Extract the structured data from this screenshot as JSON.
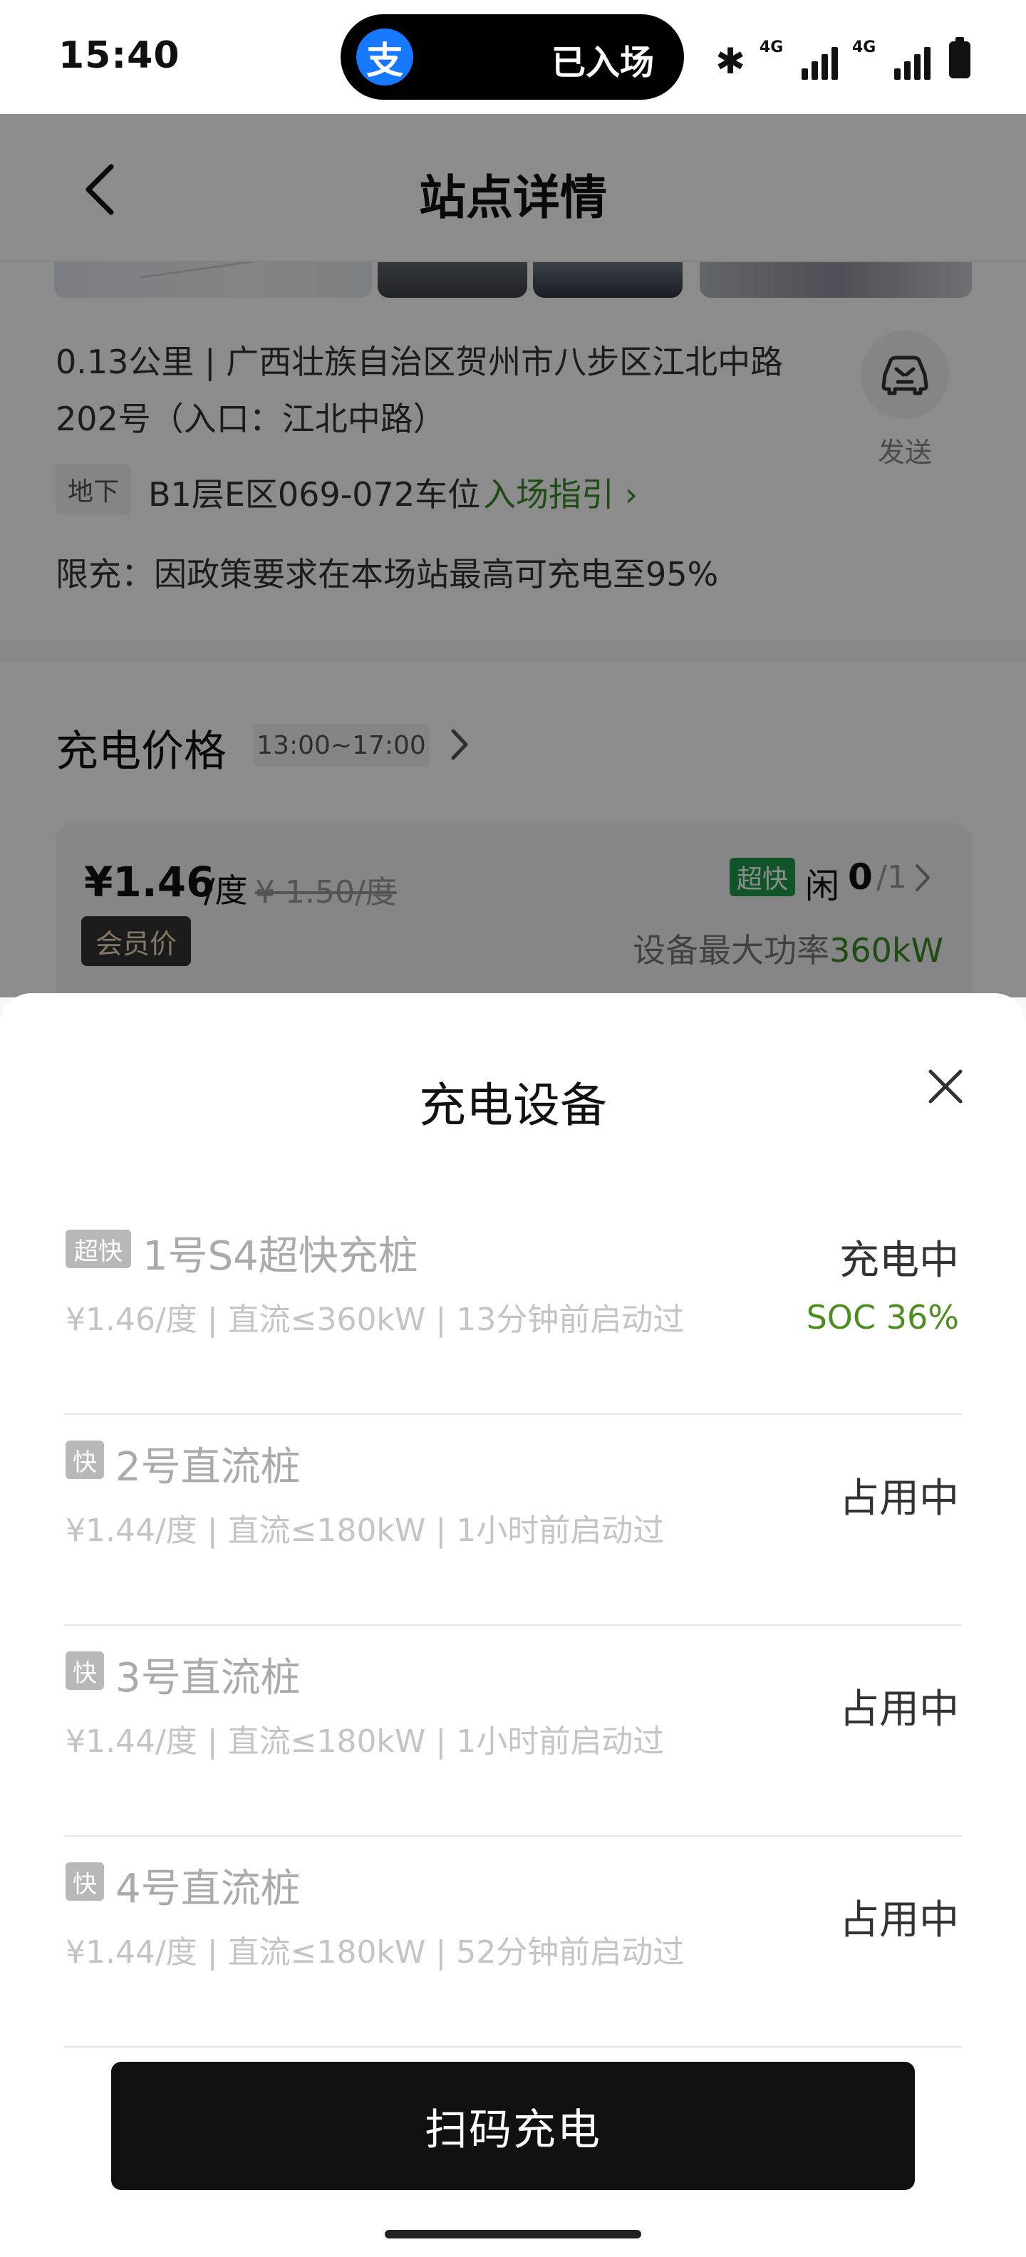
{
  "status_bar": {
    "time": "15:40",
    "island_logo": "支",
    "island_text": "已入场",
    "signal1": "4G",
    "signal2": "4G"
  },
  "nav": {
    "title": "站点详情"
  },
  "station": {
    "address": "0.13公里 | 广西壮族自治区贺州市八步区江北中路202号（入口：江北中路）",
    "send_label": "发送",
    "floor_tag": "地下",
    "floor_text": "B1层E区069-072车位",
    "guide_link": "入场指引 ›",
    "limit_text": "限充：因政策要求在本场站最高可充电至95%"
  },
  "price": {
    "heading": "充电价格",
    "time_range": "13:00~17:00",
    "current": "¥1.46",
    "unit": "/度",
    "original": "¥ 1.50/度",
    "member_tag": "会员价",
    "ultra_badge": "超快",
    "idle_label": "闲",
    "idle_count": "0",
    "idle_total": "/1",
    "max_power_label": "设备最大功率",
    "max_power_value": "360kW"
  },
  "sheet": {
    "title": "充电设备",
    "piles": [
      {
        "badge": "超快",
        "name": "1号S4超快充桩",
        "meta": "¥1.46/度 | 直流≤360kW | 13分钟前启动过",
        "status": "充电中",
        "soc": "SOC 36%"
      },
      {
        "badge": "快",
        "name": "2号直流桩",
        "meta": "¥1.44/度 | 直流≤180kW | 1小时前启动过",
        "status": "占用中"
      },
      {
        "badge": "快",
        "name": "3号直流桩",
        "meta": "¥1.44/度 | 直流≤180kW | 1小时前启动过",
        "status": "占用中"
      },
      {
        "badge": "快",
        "name": "4号直流桩",
        "meta": "¥1.44/度 | 直流≤180kW | 52分钟前启动过",
        "status": "占用中"
      }
    ],
    "scan_button": "扫码充电"
  },
  "colors": {
    "accent_green": "#3a8a26",
    "soc_green": "#4e8e1e",
    "ultra_green": "#1f9a4b",
    "alipay_blue": "#1677ff"
  }
}
